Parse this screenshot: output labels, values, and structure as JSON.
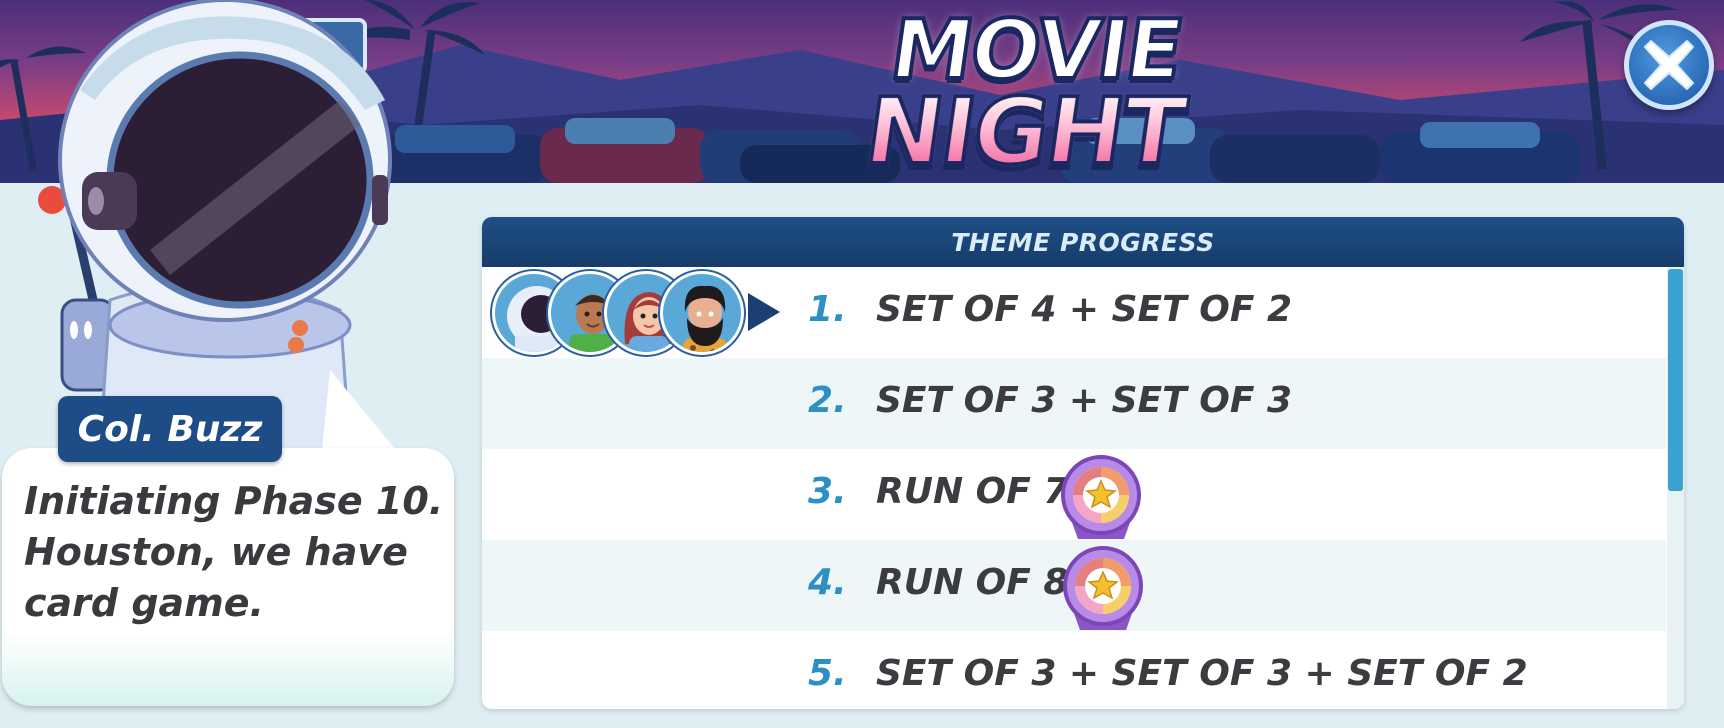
{
  "banner": {
    "title_line1": "MOVIE",
    "title_line2": "NIGHT",
    "close_icon": "close-icon"
  },
  "speaker": {
    "name": "Col. Buzz",
    "message": "Initiating Phase 10. Houston, we have card game."
  },
  "progress": {
    "title": "THEME PROGRESS",
    "current_phase": 1,
    "phases": [
      {
        "number": "1.",
        "description": "SET OF 4 + SET OF 2",
        "reward": false
      },
      {
        "number": "2.",
        "description": "SET OF 3 + SET OF 3",
        "reward": false
      },
      {
        "number": "3.",
        "description": "RUN OF 7",
        "reward": true,
        "reward_icon": "star-medal-icon"
      },
      {
        "number": "4.",
        "description": "RUN OF 8",
        "reward": true,
        "reward_icon": "star-medal-icon"
      },
      {
        "number": "5.",
        "description": "SET OF 3 + SET OF 3 + SET OF 2",
        "reward": false
      }
    ],
    "players": [
      {
        "avatar": "astronaut-avatar"
      },
      {
        "avatar": "man-green-shirt-avatar"
      },
      {
        "avatar": "woman-red-hair-avatar"
      },
      {
        "avatar": "bearded-caveman-avatar"
      }
    ]
  },
  "colors": {
    "header_bg": "#1f4f86",
    "number_color": "#2d8fc2",
    "text_color": "#3b3b40",
    "name_tag_bg": "#1d4c87"
  }
}
